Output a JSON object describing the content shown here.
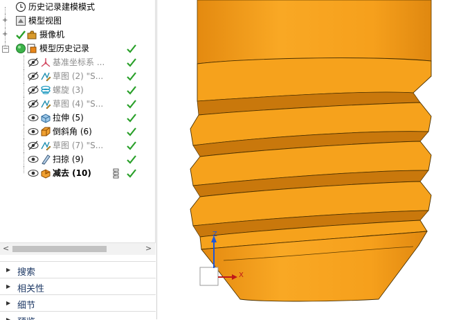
{
  "tree": {
    "items": [
      {
        "label": "历史记录建模模式"
      },
      {
        "label": "模型视图",
        "expander": "+"
      },
      {
        "label": "摄像机",
        "expander": "+"
      },
      {
        "label": "模型历史记录",
        "expander": "−"
      },
      {
        "label": "基准坐标系 ..."
      },
      {
        "label": "草图 (2) \"S..."
      },
      {
        "label": "螺旋 (3)"
      },
      {
        "label": "草图 (4) \"S..."
      },
      {
        "label": "拉伸 (5)"
      },
      {
        "label": "倒斜角 (6)"
      },
      {
        "label": "草图 (7) \"S..."
      },
      {
        "label": "扫掠 (9)"
      },
      {
        "label": "减去 (10)"
      }
    ]
  },
  "scrollbar": {
    "left": "<",
    "right": ">"
  },
  "panels": [
    {
      "label": "搜索"
    },
    {
      "label": "相关性"
    },
    {
      "label": "细节"
    },
    {
      "label": "预览"
    }
  ],
  "viewport": {
    "axis_z": "Z",
    "axis_x": "X",
    "colors": {
      "model": "#f7a21a",
      "model_shadow": "#d88410",
      "edge": "#3a2a00",
      "axis_z": "#1e56d8",
      "axis_x": "#c01818"
    }
  }
}
